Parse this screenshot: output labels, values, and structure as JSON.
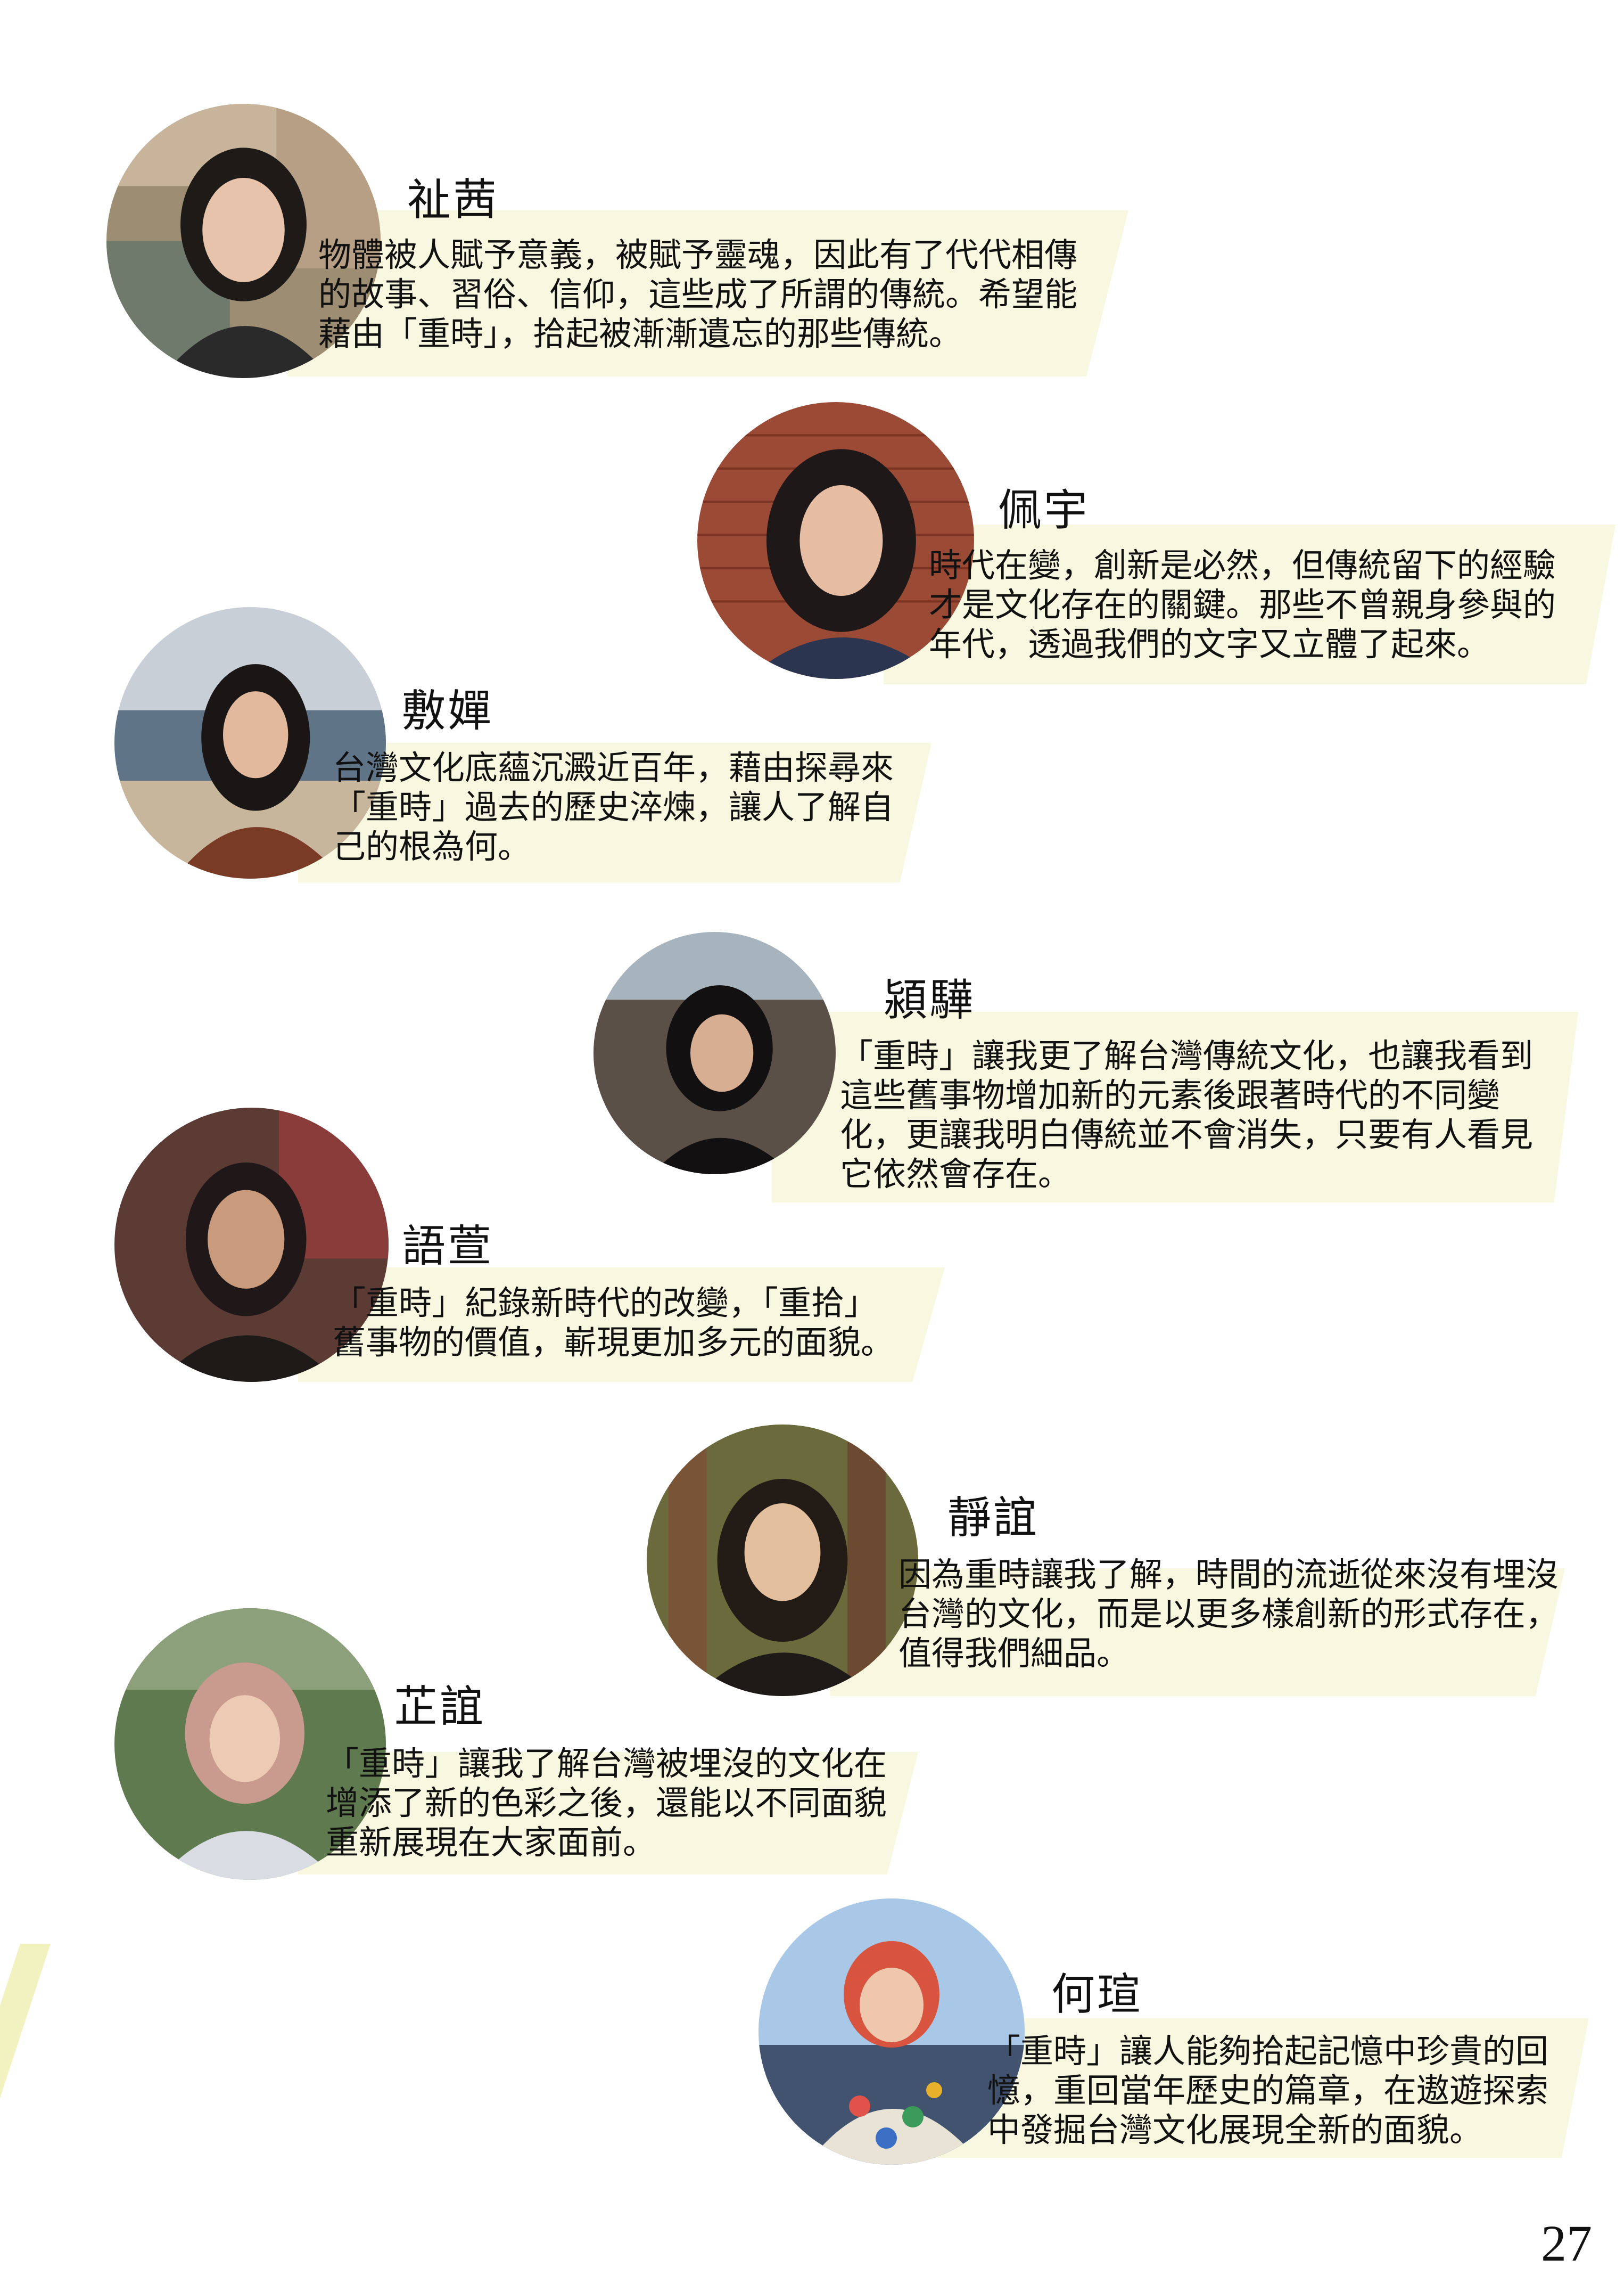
{
  "profiles": [
    {
      "name": "祉茜",
      "lines": [
        "物體被人賦予意義，被賦予靈魂，因此有了代代相傳",
        "的故事、習俗、信仰，這些成了所謂的傳統。希望能",
        "藉由「重時」，拾起被漸漸遺忘的那些傳統。"
      ]
    },
    {
      "name": "佩宇",
      "lines": [
        "時代在變，創新是必然，但傳統留下的經驗",
        "才是文化存在的關鍵。那些不曾親身參與的",
        "年代，透過我們的文字又立體了起來。"
      ]
    },
    {
      "name": "敷嬋",
      "lines": [
        "台灣文化底蘊沉澱近百年，藉由探尋來",
        "「重時」過去的歷史淬煉，讓人了解自",
        "己的根為何。"
      ]
    },
    {
      "name": "潁驊",
      "lines": [
        "「重時」讓我更了解台灣傳統文化，也讓我看到",
        "這些舊事物增加新的元素後跟著時代的不同變",
        "化，更讓我明白傳統並不會消失，只要有人看見",
        "它依然會存在。"
      ]
    },
    {
      "name": "語萱",
      "lines": [
        "「重時」紀錄新時代的改變，「重拾」",
        "舊事物的價值，嶄現更加多元的面貌。"
      ]
    },
    {
      "name": "靜誼",
      "lines": [
        "因為重時讓我了解，時間的流逝從來沒有埋沒",
        "台灣的文化，而是以更多樣創新的形式存在，",
        "值得我們細品。"
      ]
    },
    {
      "name": "芷誼",
      "lines": [
        "「重時」讓我了解台灣被埋沒的文化在",
        "增添了新的色彩之後，還能以不同面貌",
        "重新展現在大家面前。"
      ]
    },
    {
      "name": "何瑄",
      "lines": [
        "「重時」讓人能夠拾起記憶中珍貴的回",
        "憶，重回當年歷史的篇章，在遨遊探索",
        "中發掘台灣文化展現全新的面貌。"
      ]
    }
  ],
  "page_number": "27"
}
